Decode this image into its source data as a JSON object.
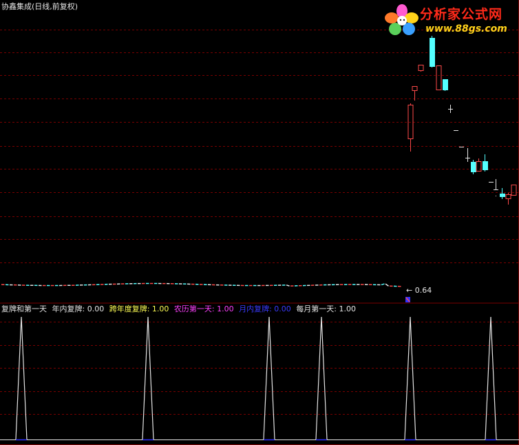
{
  "main_panel": {
    "title": "协鑫集成(日线,前复权)",
    "line_label": "0.64"
  },
  "indicator_panel": {
    "items": [
      {
        "label": "复牌和第一天",
        "color": "#e6e6e6"
      },
      {
        "label": "年内复牌: 0.00",
        "color": "#e6e6e6"
      },
      {
        "label": "跨年度复牌: 1.00",
        "color": "#ffff54"
      },
      {
        "label": "农历第一天: 1.00",
        "color": "#ff40ff"
      },
      {
        "label": "月内复牌: 0.00",
        "color": "#3a3aff"
      },
      {
        "label": "每月第一天: 1.00",
        "color": "#e6e6e6"
      }
    ]
  },
  "watermark": {
    "title": "分析家公式网",
    "url": "www.88gs.com",
    "logo_icon": "flower-logo-icon"
  },
  "colors": {
    "background": "#000000",
    "grid": "#7a0000",
    "up": "#ff4a4a",
    "down": "#54ffff",
    "neutral": "#e6e6e6",
    "indicator_line": "#e6e6e6",
    "indicator_base": "#3030ff"
  }
}
